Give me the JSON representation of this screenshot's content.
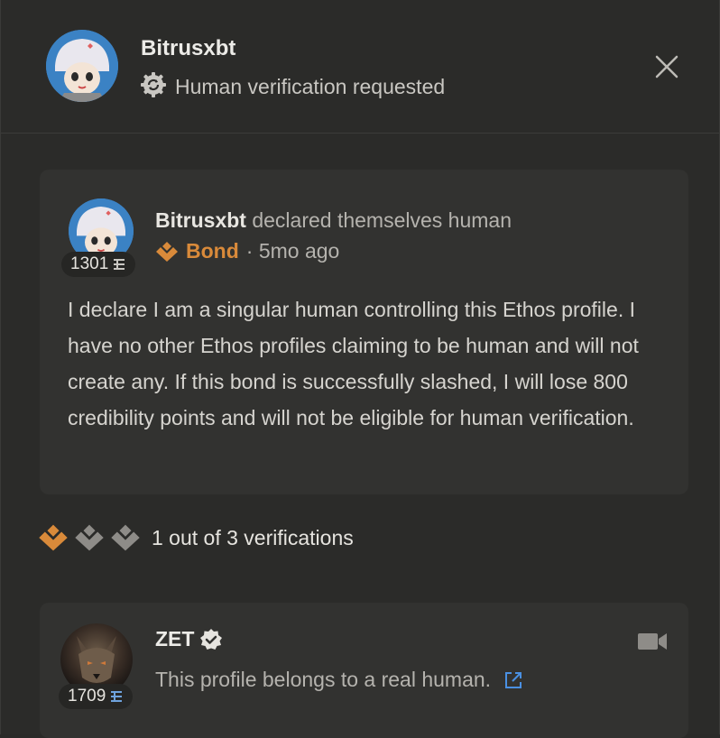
{
  "header": {
    "name": "Bitrusxbt",
    "status_label": "Human verification requested"
  },
  "declaration": {
    "name": "Bitrusxbt",
    "action_text": "declared themselves human",
    "score": "1301",
    "bond_label": "Bond",
    "time": "· 5mo ago",
    "body": "I declare I am a singular human controlling this Ethos profile. I have no other Ethos profiles claiming to be human and will not create any. If this bond is successfully slashed, I will lose 800 credibility points and will not be eligible for human verification."
  },
  "verifications": {
    "text": "1 out of 3 verifications",
    "completed": 1,
    "total": 3
  },
  "verifier": {
    "name": "ZET",
    "score": "1709",
    "message": "This profile belongs to a real human."
  },
  "colors": {
    "accent_orange": "#d98a3a",
    "link_blue": "#4a90e2",
    "background": "#2b2b29",
    "card": "#323230"
  }
}
